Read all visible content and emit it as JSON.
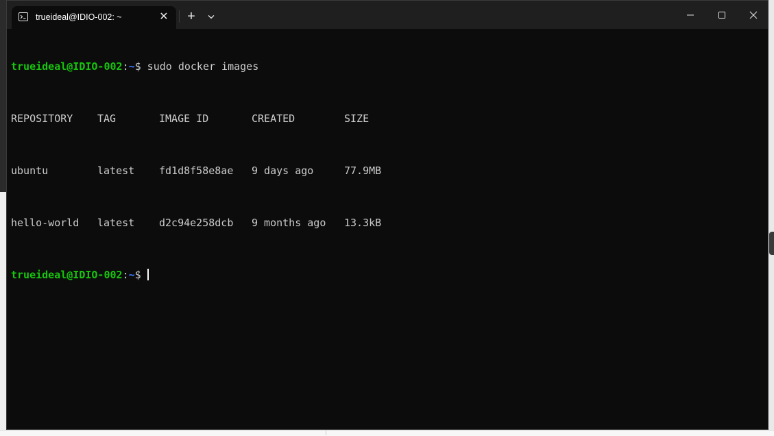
{
  "window": {
    "tab_title": "trueideal@IDIO-002: ~",
    "tab_close_symbol": "✕",
    "new_tab_symbol": "+"
  },
  "terminal": {
    "prompt_user": "trueideal@IDIO-002",
    "prompt_colon": ":",
    "prompt_path": "~",
    "prompt_dollar": "$",
    "command": " sudo docker images",
    "table": {
      "headers": [
        "REPOSITORY",
        "TAG",
        "IMAGE ID",
        "CREATED",
        "SIZE"
      ],
      "rows": [
        [
          "ubuntu",
          "latest",
          "fd1d8f58e8ae",
          "9 days ago",
          "77.9MB"
        ],
        [
          "hello-world",
          "latest",
          "d2c94e258dcb",
          "9 months ago",
          "13.3kB"
        ]
      ]
    }
  },
  "colors": {
    "prompt_user": "#16c60c",
    "prompt_path": "#3b78ff",
    "terminal_bg": "#0c0c0c",
    "titlebar_bg": "#1f1f1f"
  },
  "icons": {
    "tab": "terminal-icon",
    "dropdown": "chevron-down-icon",
    "minimize": "minimize-icon",
    "maximize": "maximize-icon",
    "close": "close-icon"
  }
}
